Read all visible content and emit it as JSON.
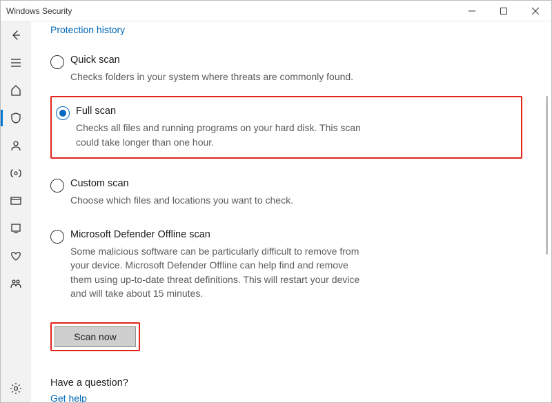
{
  "window": {
    "title": "Windows Security"
  },
  "sidebar": {
    "items": [
      {
        "name": "back-icon"
      },
      {
        "name": "menu-icon"
      },
      {
        "name": "home-icon"
      },
      {
        "name": "shield-icon"
      },
      {
        "name": "account-icon"
      },
      {
        "name": "firewall-icon"
      },
      {
        "name": "app-browser-icon"
      },
      {
        "name": "device-security-icon"
      },
      {
        "name": "heart-icon"
      },
      {
        "name": "family-icon"
      }
    ],
    "footer": {
      "name": "settings-icon"
    }
  },
  "main": {
    "top_link": "Protection history",
    "options": [
      {
        "id": "quick",
        "title": "Quick scan",
        "desc": "Checks folders in your system where threats are commonly found.",
        "selected": false
      },
      {
        "id": "full",
        "title": "Full scan",
        "desc": "Checks all files and running programs on your hard disk. This scan could take longer than one hour.",
        "selected": true
      },
      {
        "id": "custom",
        "title": "Custom scan",
        "desc": "Choose which files and locations you want to check.",
        "selected": false
      },
      {
        "id": "offline",
        "title": "Microsoft Defender Offline scan",
        "desc": "Some malicious software can be particularly difficult to remove from your device. Microsoft Defender Offline can help find and remove them using up-to-date threat definitions. This will restart your device and will take about 15 minutes.",
        "selected": false
      }
    ],
    "scan_button": "Scan now",
    "question": {
      "title": "Have a question?",
      "link": "Get help"
    }
  }
}
